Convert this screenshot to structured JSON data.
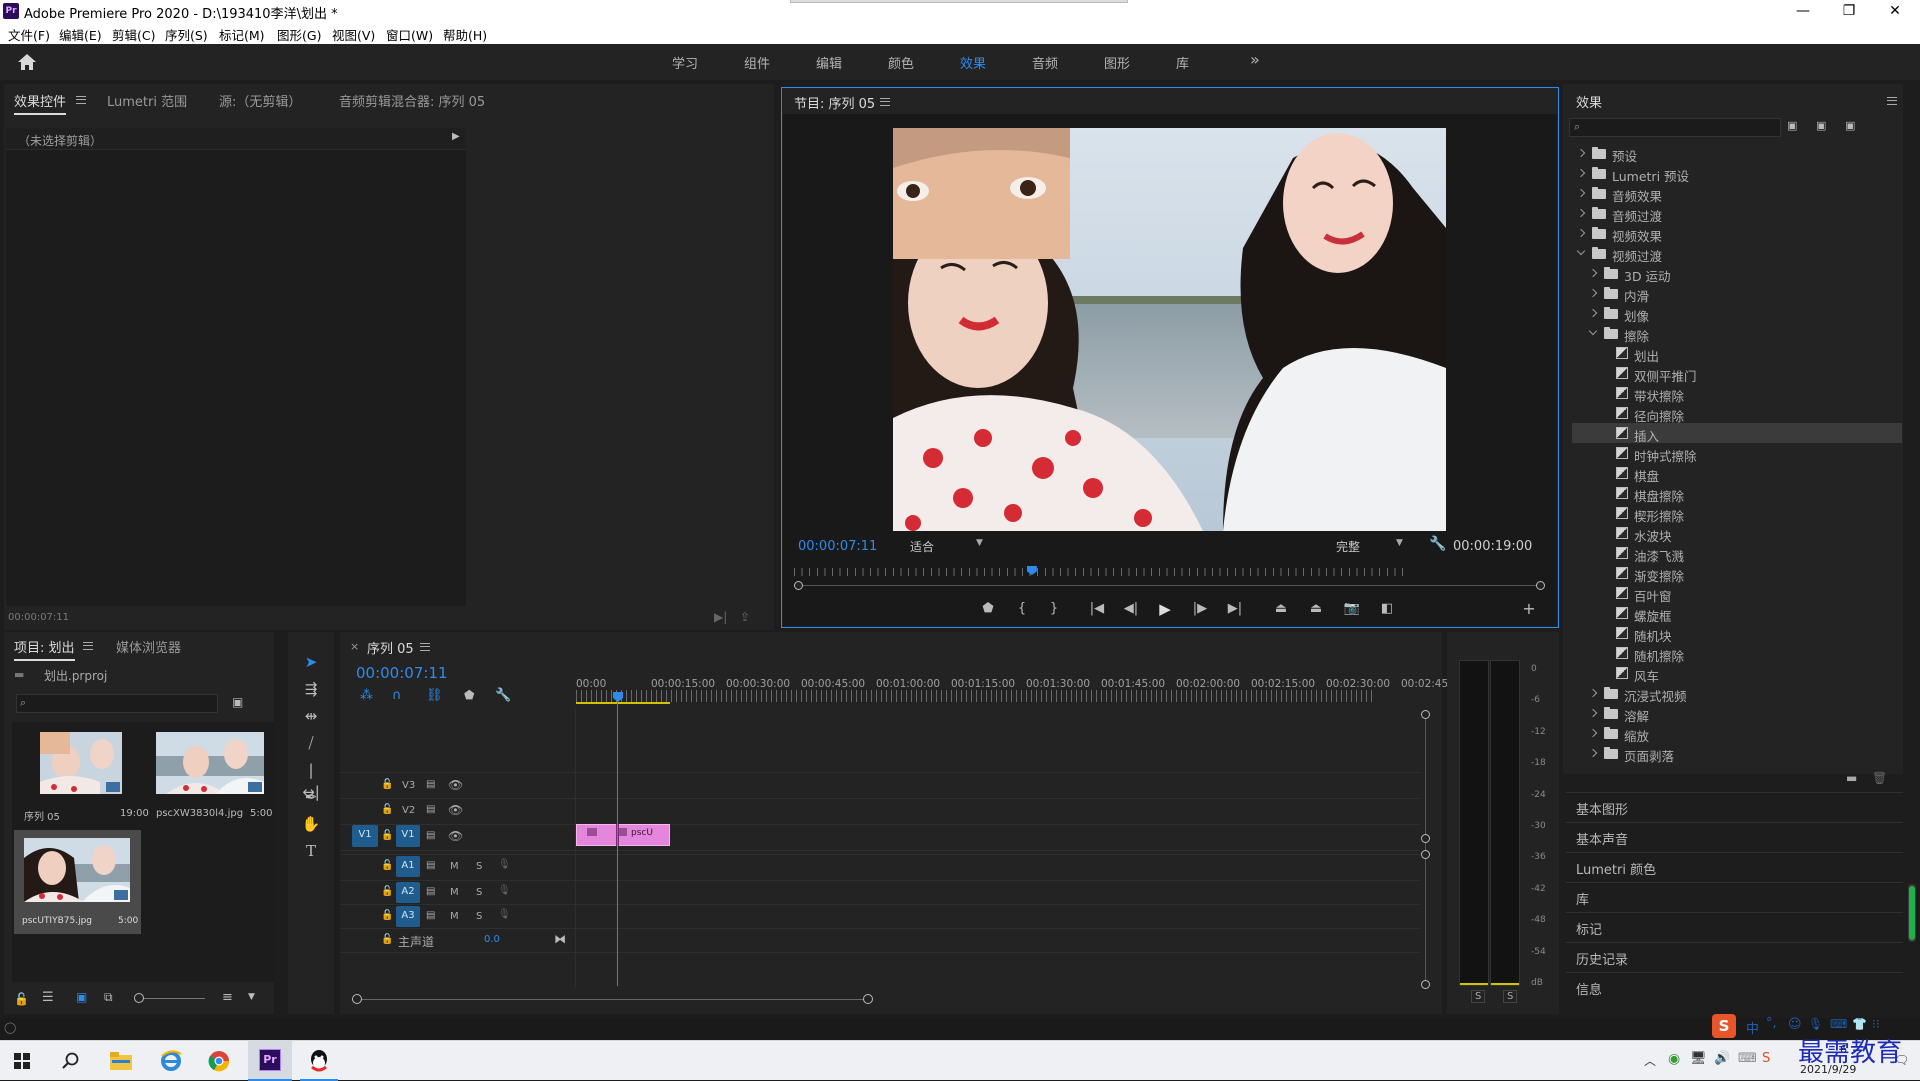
{
  "app": {
    "logo_text": "Pr",
    "title": "Adobe Premiere Pro 2020 - D:\\193410李洋\\划出 *",
    "win_controls": [
      "—",
      "❐",
      "✕"
    ]
  },
  "menu": [
    "文件(F)",
    "编辑(E)",
    "剪辑(C)",
    "序列(S)",
    "标记(M)",
    "图形(G)",
    "视图(V)",
    "窗口(W)",
    "帮助(H)"
  ],
  "workspaces": {
    "items": [
      "学习",
      "组件",
      "编辑",
      "颜色",
      "效果",
      "音频",
      "图形",
      "库"
    ],
    "active": "效果",
    "more": "»"
  },
  "source_panel": {
    "tabs": [
      "效果控件",
      "Lumetri 范围",
      "源:（无剪辑）",
      "音频剪辑混合器: 序列 05"
    ],
    "no_clip": "（未选择剪辑）",
    "timecode": "00:00:07:11"
  },
  "program_monitor": {
    "title": "节目: 序列 05",
    "timecode": "00:00:07:11",
    "fit": "适合",
    "quality": "完整",
    "duration": "00:00:19:00",
    "playhead_fraction": 0.39,
    "inset_fraction": 0.32
  },
  "project_panel": {
    "tabs": [
      "项目: 划出",
      "媒体浏览器"
    ],
    "file_name": "划出.prproj",
    "items": [
      {
        "name": "序列 05",
        "duration": "19:00"
      },
      {
        "name": "pscXW3830l4.jpg",
        "duration": "5:00"
      },
      {
        "name": "pscUTIYB75.jpg",
        "duration": "5:00"
      }
    ]
  },
  "timeline": {
    "tab": "序列 05",
    "timecode": "00:00:07:11",
    "ruler": [
      "00:00",
      "00:00:15:00",
      "00:00:30:00",
      "00:00:45:00",
      "00:01:00:00",
      "00:01:15:00",
      "00:01:30:00",
      "00:01:45:00",
      "00:02:00:00",
      "00:02:15:00",
      "00:02:30:00",
      "00:02:45:"
    ],
    "video_tracks": [
      "V3",
      "V2",
      "V1"
    ],
    "source_patch": "V1",
    "audio_tracks": [
      "A1",
      "A2",
      "A3"
    ],
    "m": "M",
    "s": "S",
    "master": {
      "label": "主声道",
      "value": "0.0"
    },
    "clip_label": "pscU"
  },
  "meter": {
    "ticks": [
      "0",
      "-6",
      "-12",
      "-18",
      "-24",
      "-30",
      "-36",
      "-42",
      "-48",
      "-54",
      "dB"
    ],
    "solo": [
      "S",
      "S"
    ]
  },
  "effects_panel": {
    "title": "效果",
    "tree": [
      {
        "label": "预设",
        "level": 0,
        "type": "folder-special",
        "state": "closed"
      },
      {
        "label": "Lumetri 预设",
        "level": 0,
        "type": "folder-special",
        "state": "closed"
      },
      {
        "label": "音频效果",
        "level": 0,
        "type": "folder",
        "state": "closed"
      },
      {
        "label": "音频过渡",
        "level": 0,
        "type": "folder",
        "state": "closed"
      },
      {
        "label": "视频效果",
        "level": 0,
        "type": "folder",
        "state": "closed"
      },
      {
        "label": "视频过渡",
        "level": 0,
        "type": "folder",
        "state": "open"
      },
      {
        "label": "3D 运动",
        "level": 1,
        "type": "folder",
        "state": "closed"
      },
      {
        "label": "内滑",
        "level": 1,
        "type": "folder",
        "state": "closed"
      },
      {
        "label": "划像",
        "level": 1,
        "type": "folder",
        "state": "closed"
      },
      {
        "label": "擦除",
        "level": 1,
        "type": "folder",
        "state": "open"
      },
      {
        "label": "划出",
        "level": 2,
        "type": "effect"
      },
      {
        "label": "双侧平推门",
        "level": 2,
        "type": "effect"
      },
      {
        "label": "带状擦除",
        "level": 2,
        "type": "effect"
      },
      {
        "label": "径向擦除",
        "level": 2,
        "type": "effect"
      },
      {
        "label": "插入",
        "level": 2,
        "type": "effect",
        "selected": true
      },
      {
        "label": "时钟式擦除",
        "level": 2,
        "type": "effect"
      },
      {
        "label": "棋盘",
        "level": 2,
        "type": "effect"
      },
      {
        "label": "棋盘擦除",
        "level": 2,
        "type": "effect"
      },
      {
        "label": "楔形擦除",
        "level": 2,
        "type": "effect"
      },
      {
        "label": "水波块",
        "level": 2,
        "type": "effect"
      },
      {
        "label": "油漆飞溅",
        "level": 2,
        "type": "effect"
      },
      {
        "label": "渐变擦除",
        "level": 2,
        "type": "effect"
      },
      {
        "label": "百叶窗",
        "level": 2,
        "type": "effect"
      },
      {
        "label": "螺旋框",
        "level": 2,
        "type": "effect"
      },
      {
        "label": "随机块",
        "level": 2,
        "type": "effect"
      },
      {
        "label": "随机擦除",
        "level": 2,
        "type": "effect"
      },
      {
        "label": "风车",
        "level": 2,
        "type": "effect"
      },
      {
        "label": "沉浸式视频",
        "level": 1,
        "type": "folder",
        "state": "closed"
      },
      {
        "label": "溶解",
        "level": 1,
        "type": "folder",
        "state": "closed"
      },
      {
        "label": "缩放",
        "level": 1,
        "type": "folder",
        "state": "closed"
      },
      {
        "label": "页面剥落",
        "level": 1,
        "type": "folder",
        "state": "closed"
      }
    ],
    "collapsed_panels": [
      "基本图形",
      "基本声音",
      "Lumetri 颜色",
      "库",
      "标记",
      "历史记录",
      "信息"
    ]
  },
  "taskbar": {
    "ime": [
      "中",
      "°,",
      "☺",
      "🎙",
      "⌨",
      "👕",
      "⁝⁝"
    ],
    "watermark": "最需教育",
    "time_line": "6",
    "date": "2021/9/29"
  },
  "colors": {
    "accent": "#2d8ceb",
    "clip_pink": "#e486dc",
    "track_blue": "#1f5d8f",
    "playhead": "#2d8ceb",
    "work_area": "#d3c200"
  }
}
